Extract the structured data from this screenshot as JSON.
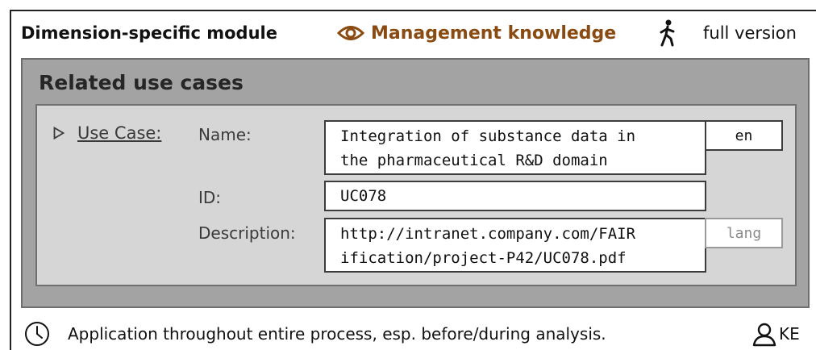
{
  "header": {
    "title": "Dimension-specific module",
    "knowledge_label": "Management knowledge",
    "knowledge_icon": "eye-icon",
    "walk_icon": "walking-person-icon",
    "version_label": "full version",
    "accent_color": "#8a4b12"
  },
  "panel": {
    "title": "Related use cases",
    "use_case": {
      "link_label": "Use Case:",
      "name_label": "Name:",
      "name_value": "Integration of substance data in\nthe pharmaceutical R&D domain",
      "name_lang": "en",
      "id_label": "ID:",
      "id_value": "UC078",
      "description_label": "Description:",
      "description_value": "http://intranet.company.com/FAIR\nification/project-P42/UC078.pdf",
      "description_lang_placeholder": "lang"
    }
  },
  "footer": {
    "clock_icon": "clock-icon",
    "text": "Application throughout entire process, esp. before/during analysis.",
    "user_icon": "user-icon",
    "role": "KE"
  }
}
